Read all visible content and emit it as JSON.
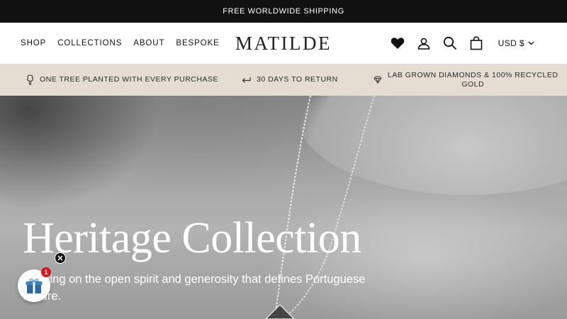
{
  "announcement": {
    "text": "FREE WORLDWIDE SHIPPING"
  },
  "header": {
    "nav": [
      {
        "label": "SHOP"
      },
      {
        "label": "COLLECTIONS"
      },
      {
        "label": "ABOUT"
      },
      {
        "label": "BESPOKE"
      }
    ],
    "logo": "MATILDE",
    "icons": [
      "heart-icon",
      "account-icon",
      "search-icon",
      "bag-icon"
    ],
    "currency": "USD $"
  },
  "usp_bar": {
    "items": [
      {
        "icon": "tree-icon",
        "text": "ONE TREE PLANTED WITH EVERY PURCHASE"
      },
      {
        "icon": "return-arrow-icon",
        "text": "30 DAYS TO RETURN"
      },
      {
        "icon": "diamond-icon",
        "text_line1": "LAB GROWN DIAMONDS & 100% RECYCLED",
        "text_line2": "GOLD"
      }
    ]
  },
  "hero": {
    "title": "Heritage Collection",
    "subtitle": "Drawing on the open spirit and generosity that defines Portuguese culture."
  },
  "gift_widget": {
    "badge": "1",
    "icon": "gift-icon",
    "close_icon": "close-icon"
  },
  "colors": {
    "announcement_bg": "#111111",
    "usp_bg": "#e6ddd2",
    "badge": "#d11b1b"
  }
}
